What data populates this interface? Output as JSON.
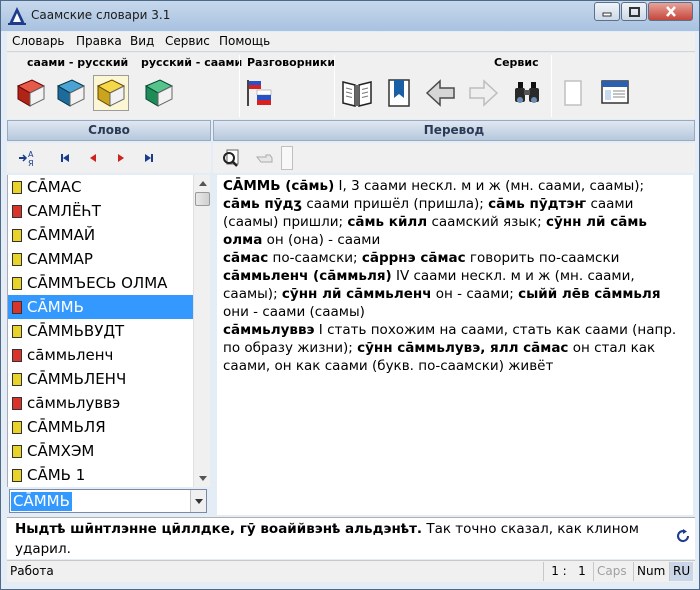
{
  "window": {
    "title": "Саамские словари 3.1"
  },
  "menu": [
    "Словарь",
    "Правка",
    "Вид",
    "Сервис",
    "Помощь"
  ],
  "toolbar": {
    "group1_label": "саами - русский",
    "group2_label": "русский - саами",
    "group3_label": "Разговорники",
    "group4_label": "Сервис"
  },
  "panes": {
    "left_header": "Слово",
    "right_header": "Перевод"
  },
  "words": [
    "СА̄МАС",
    "САМЛЁҺТ",
    "СА̄ММАЙ",
    "САММАР",
    "СА̄ММЪЕСЬ ОЛМА",
    "СА̄ММЬ",
    "СА̄ММЬВУДТ",
    "са̄ммьленч",
    "СА̄ММЬЛЕНЧ",
    "са̄ммьлуввэ",
    "СА̄ММЬЛЯ",
    "СА̄МХЭМ",
    "СА̄МЬ 1"
  ],
  "selected_word_index": 5,
  "search": {
    "value": "СА̄ММЬ"
  },
  "translation": {
    "e1": {
      "hw": "СА̄ММЬ (са̄мь)",
      "t1": " I, 3 саами нескл. м и ж (мн. саами, саамы); ",
      "b1": "са̄мь пӯдӡ",
      "t2": " саами пришёл (пришла); ",
      "b2": "са̄мь пӯдтэҥ",
      "t3": " саами (саамы) пришли; ",
      "b3": "са̄мь кӣлл",
      "t4": " саамский язык; ",
      "b4": "сӯнн лӣ са̄мь олма",
      "t5": " он (она) - саами"
    },
    "e2": {
      "hw": "са̄мас",
      "t1": " по-саамски; ",
      "b1": "са̄ррнэ са̄мас",
      "t2": " говорить по-саамски"
    },
    "e3": {
      "hw": "са̄ммьленч (са̄ммьля)",
      "t1": " IV саами нескл. м и ж (мн. саами, саамы); ",
      "b1": "сӯнн лӣ са̄ммьленч",
      "t2": " он - саами; ",
      "b2": "сыйй лēв са̄ммьля",
      "t3": " они - саами (саамы)"
    },
    "e4": {
      "hw": "са̄ммьлуввэ",
      "t1": " I стать похожим на саами, стать как саами (напр. по образу жизни); ",
      "b1": "сӯнн са̄ммьлувэ, ялл са̄мас",
      "t2": " он стал как саами, он как саами (букв. по-саамски) живёт"
    }
  },
  "proverb": {
    "bold": "Ныдтҍ шӣнтлэнне цӣллдке, гӯ воаййвэнҍ альдэнҍт.",
    "rest": " Так точно сказал, как клином ударил."
  },
  "status": {
    "text": "Работа",
    "pos": "1 :   1",
    "caps": "Caps",
    "num": "Num",
    "lang": "RU"
  }
}
